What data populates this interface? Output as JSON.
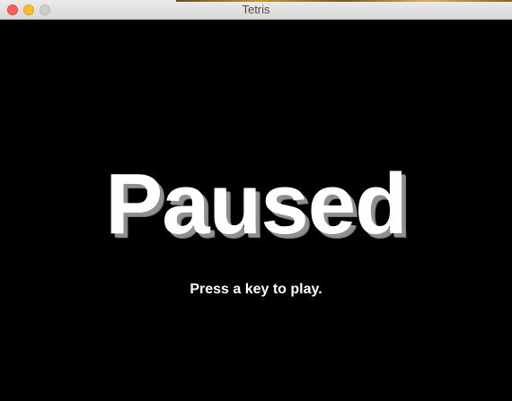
{
  "window": {
    "title": "Tetris",
    "controls": {
      "close": "close-button",
      "minimize": "minimize-button",
      "zoom": "zoom-button"
    }
  },
  "game": {
    "status_title": "Paused",
    "prompt": "Press a key to play."
  },
  "colors": {
    "background": "#000000",
    "text": "#ffffff",
    "shadow": "#8f8f8f",
    "close": "#fc5f57",
    "minimize": "#fdbc2e",
    "zoom": "#cfcfcf"
  }
}
